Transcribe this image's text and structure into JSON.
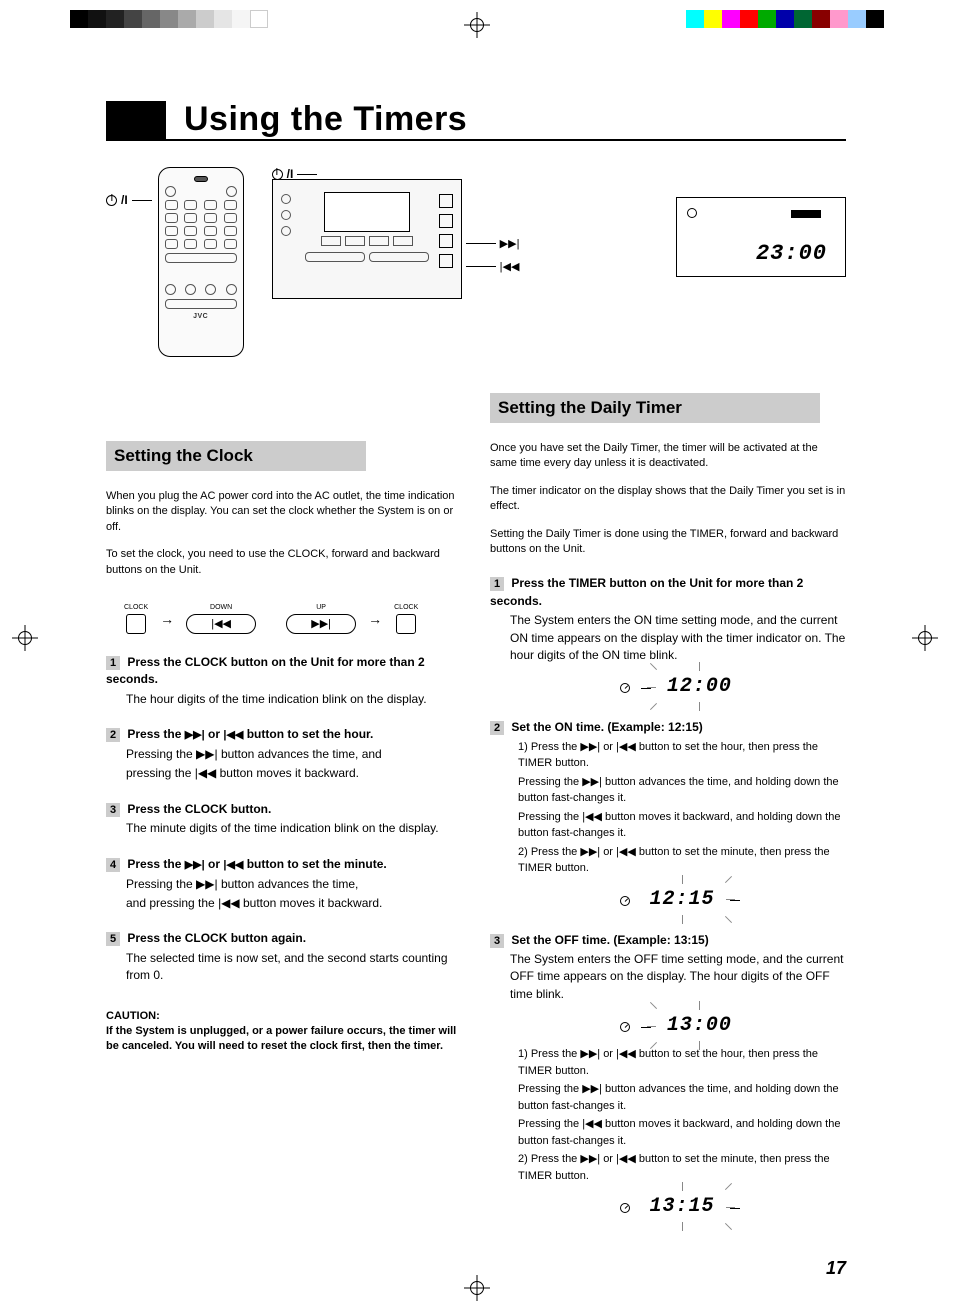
{
  "title": "Using the Timers",
  "page_number": "17",
  "display_main": "23:00",
  "brand": "JVC",
  "section_left": {
    "header": "Setting the Clock",
    "intro": "When you plug the AC power cord into the AC outlet, the time indication blinks on the display. You can set the clock whether the System is on or off.",
    "seq_desc": "To set the clock, you need to use the CLOCK, forward and backward buttons on the Unit.",
    "steps": [
      {
        "head": "Press the CLOCK button on the Unit for more than 2 seconds.",
        "body": "The hour digits of the time indication blink on the display."
      },
      {
        "head_pre": "Press the ",
        "head_mid": " or ",
        "head_post": " button to set the hour.",
        "body_line1": "Pressing the ▶▶| button advances the time, and",
        "body_line2": "pressing the |◀◀ button moves it backward."
      },
      {
        "head": "Press the CLOCK button.",
        "body": "The minute digits of the time indication blink on the display."
      },
      {
        "head_pre": "Press the ",
        "head_mid": " or ",
        "head_post": " button to set the minute.",
        "body_line1": "Pressing the ▶▶| button advances the time,",
        "body_line2": "and pressing the |◀◀ button moves it backward."
      },
      {
        "head": "Press the CLOCK button again.",
        "body": "The selected time is now set, and the second starts counting from 0."
      }
    ],
    "caution_head": "CAUTION:",
    "caution_body": "If the System is unplugged, or a power failure occurs, the timer will be canceled. You will need to reset the clock first, then the timer."
  },
  "section_right": {
    "header": "Setting the Daily Timer",
    "intro1": "Once you have set the Daily Timer, the timer will be activated at the same time every day unless it is deactivated.",
    "intro2": "The timer indicator on the display shows that the Daily Timer you set is in effect.",
    "intro3": "Setting the Daily Timer is done using the TIMER, forward and backward buttons on the Unit.",
    "steps": [
      {
        "head": "Press the TIMER button on the Unit for more than 2 seconds.",
        "body": "The System enters the ON time setting mode, and the current ON time appears on the display with the timer indicator on. The hour digits of the ON time blink.",
        "display": "12:00",
        "flash": "hour"
      },
      {
        "head": "Set the ON time. (Example: 12:15)",
        "lines": [
          "1) Press the ▶▶| or |◀◀ button to set the hour, then press the TIMER button.",
          "Pressing the ▶▶| button advances the time, and holding down the button fast-changes it.",
          "Pressing the |◀◀ button moves it backward, and holding down the button fast-changes it.",
          "2) Press the ▶▶| or |◀◀ button to set the minute, then press the TIMER button."
        ],
        "display": "12:15",
        "flash": "minute"
      },
      {
        "head": "Set the OFF time. (Example: 13:15)",
        "intro": "The System enters the OFF time setting mode, and the current OFF time appears on the display. The hour digits of the OFF time blink.",
        "display1": "13:00",
        "lines": [
          "1) Press the ▶▶| or |◀◀ button to set the hour, then press the TIMER button.",
          "Pressing the ▶▶| button advances the time, and holding down the button fast-changes it.",
          "Pressing the |◀◀ button moves it backward, and holding down the button fast-changes it.",
          "2) Press the ▶▶| or |◀◀ button to set the minute, then press the TIMER button."
        ],
        "display2": "13:15"
      }
    ]
  },
  "glyphs": {
    "fwd": "▶▶|",
    "back": "|◀◀",
    "arrow": "→"
  }
}
